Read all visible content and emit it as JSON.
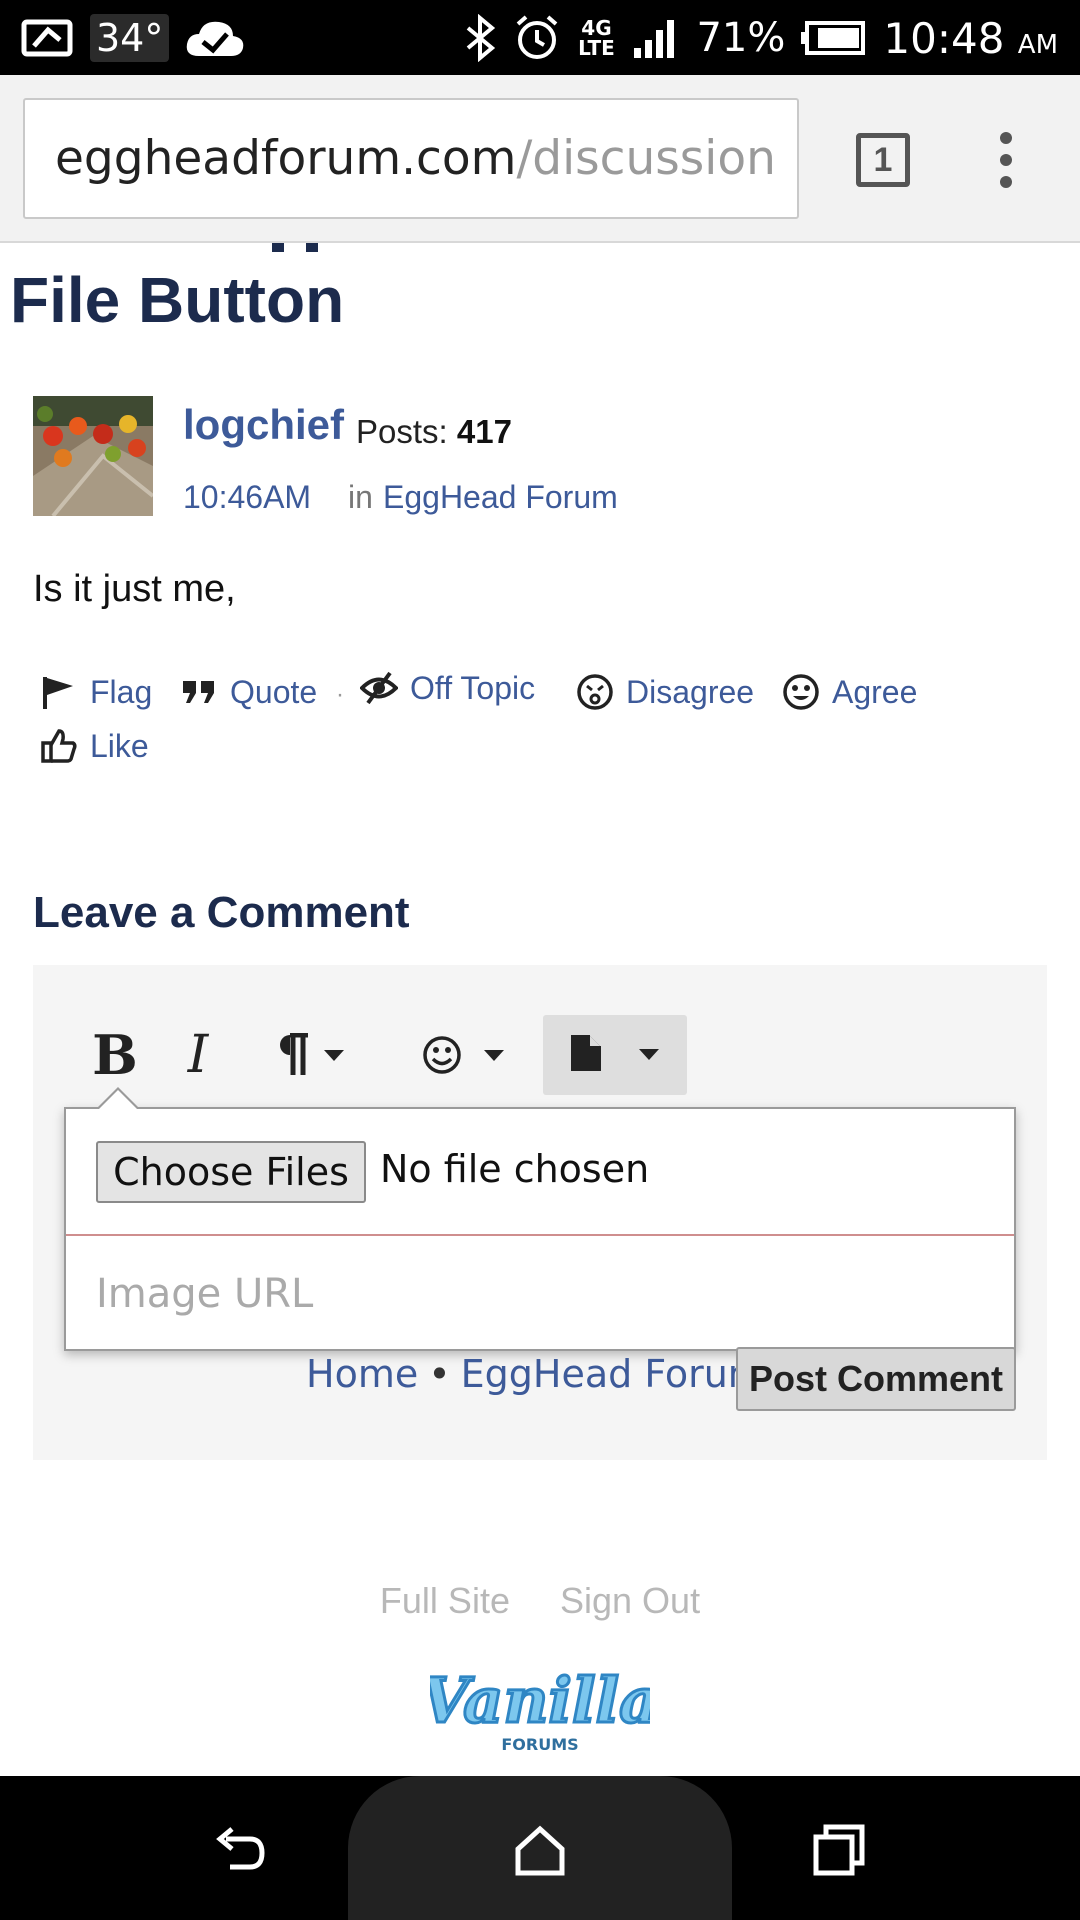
{
  "status_bar": {
    "temperature": "34°",
    "battery_percent": "71%",
    "time": "10:48",
    "ampm": "AM",
    "network": "4G LTE"
  },
  "browser": {
    "url_domain": "eggheadforum.com",
    "url_path": "/discussion",
    "tab_count": "1"
  },
  "post": {
    "title": "File Button",
    "author": "logchief",
    "posts_label": "Posts:",
    "posts_count": "417",
    "time": "10:46AM",
    "in_label": "in",
    "category": "EggHead Forum",
    "body": "Is it just me,"
  },
  "reactions": [
    {
      "label": "Flag",
      "icon": "flag-icon"
    },
    {
      "label": "Quote",
      "icon": "quote-icon"
    },
    {
      "label": "Off Topic",
      "icon": "off-topic-icon"
    },
    {
      "label": "Disagree",
      "icon": "disagree-icon"
    },
    {
      "label": "Agree",
      "icon": "agree-icon"
    },
    {
      "label": "Like",
      "icon": "thumbs-up-icon"
    }
  ],
  "comment": {
    "heading": "Leave a Comment",
    "choose_files_label": "Choose Files",
    "no_file_text": "No file chosen",
    "image_url_placeholder": "Image URL",
    "breadcrumb_home": "Home",
    "breadcrumb_sep": "•",
    "breadcrumb_category": "EggHead Forum",
    "post_button": "Post Comment"
  },
  "footer": {
    "full_site": "Full Site",
    "sign_out": "Sign Out",
    "logo_text": "Vanilla",
    "logo_subtext": "FORUMS"
  },
  "colors": {
    "link": "#3d5a99",
    "heading": "#1c2b4d",
    "logo_blue": "#5aaee0"
  }
}
